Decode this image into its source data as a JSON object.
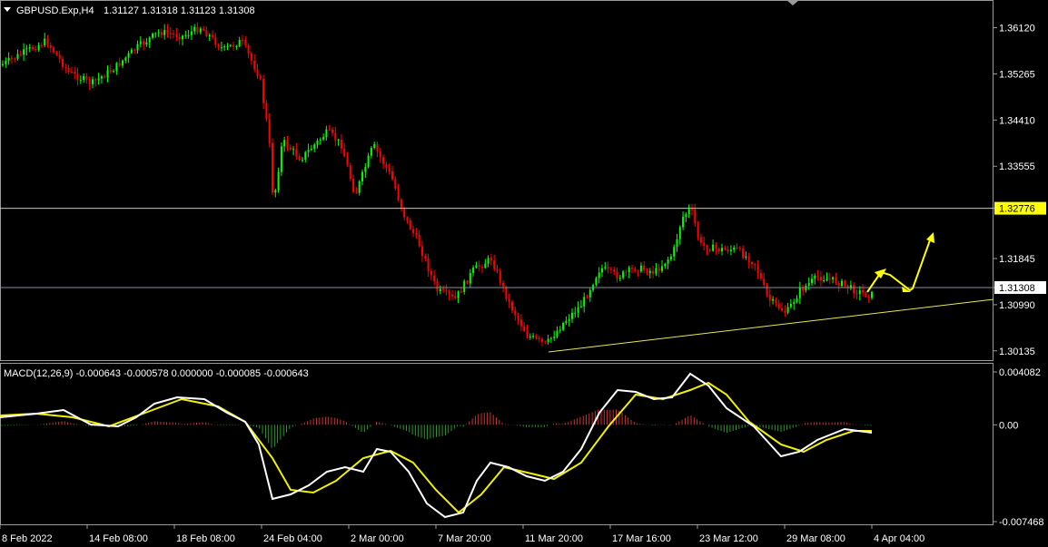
{
  "window": {
    "symbol_label": "GBPUSD.Exp,H4",
    "ohlc_label": "1.31127 1.31318 1.31123 1.31308",
    "dropdown_icon": "triangle-down-icon"
  },
  "main_chart": {
    "price_labels": [
      "1.36120",
      "1.35265",
      "1.34410",
      "1.33555",
      "1.32776",
      "1.31845",
      "1.31308",
      "1.30990",
      "1.30135"
    ],
    "price_values": [
      1.3612,
      1.35265,
      1.3441,
      1.33555,
      1.32776,
      1.31845,
      1.31308,
      1.3099,
      1.30135
    ],
    "ylim": [
      1.2998,
      1.366
    ],
    "resistance_label": "1.32776",
    "resistance_value": 1.32776,
    "current_label": "1.31308",
    "current_value": 1.31308,
    "colors": {
      "bull": "#00ff00",
      "bear": "#ff0000",
      "resistance": "#d4d450",
      "current": "#8c8ca0",
      "trend": "#e8e84c",
      "arrow": "#ffff00"
    }
  },
  "macd": {
    "title": "MACD(12,26,9) -0.000643 -0.000578 0.000000 -0.000085 -0.000643",
    "axis_labels": [
      "0.004082",
      "0.00",
      "-0.007468"
    ],
    "axis_values": [
      0.004082,
      0.0,
      -0.007468
    ]
  },
  "time_axis": {
    "labels": [
      "8 Feb 2022",
      "14 Feb 08:00",
      "18 Feb 08:00",
      "24 Feb 04:00",
      "2 Mar 00:00",
      "7 Mar 20:00",
      "11 Mar 20:00",
      "17 Mar 16:00",
      "23 Mar 12:00",
      "29 Mar 08:00",
      "4 Apr 04:00"
    ]
  }
}
